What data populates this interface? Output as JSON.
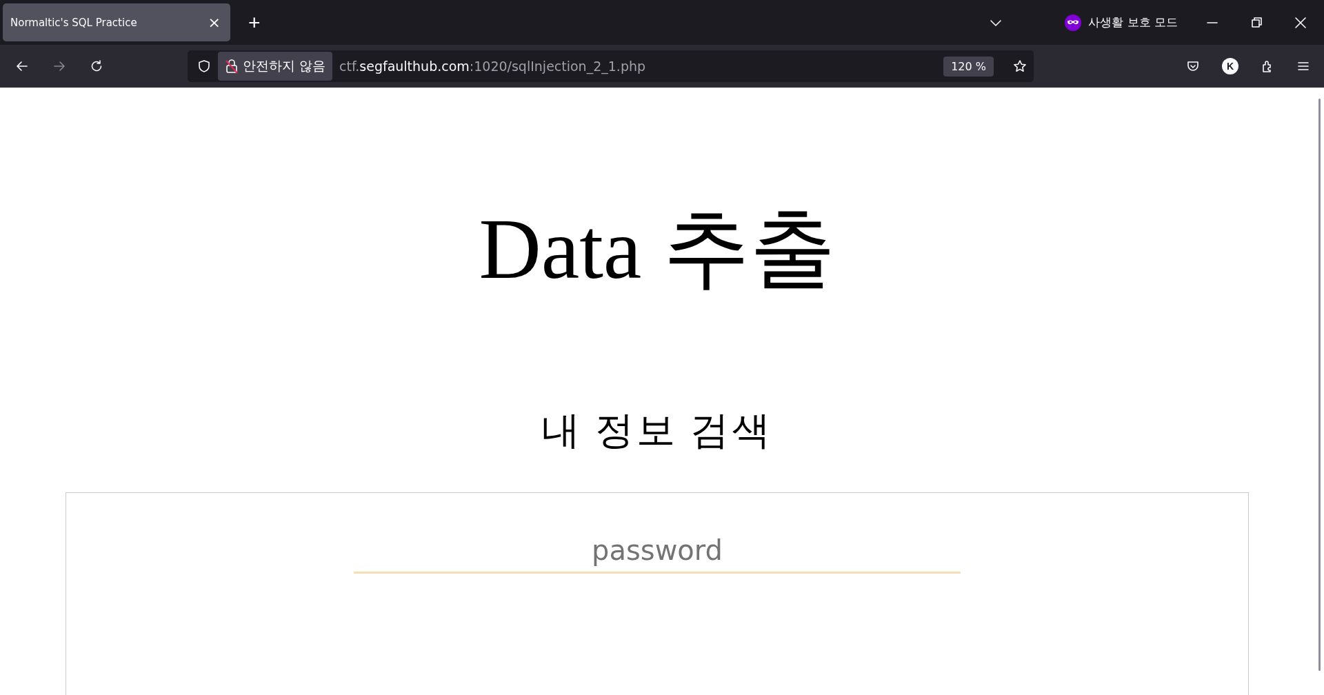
{
  "tabs": [
    {
      "title": "Normaltic's SQL Practice",
      "close": "×",
      "selected": true
    }
  ],
  "new_tab": "+",
  "private_mode": {
    "label": "사생활 보호 모드"
  },
  "toolbar": {
    "security_label": "안전하지 않음",
    "url": [
      {
        "text": "ctf.",
        "emphasis": false
      },
      {
        "text": "segfaulthub.com",
        "emphasis": true
      },
      {
        "text": ":1020/sqlInjection_2_1.php",
        "emphasis": false
      }
    ],
    "zoom": "120 %",
    "account_initial": "K"
  },
  "page": {
    "title": "Data 추출",
    "subtitle": "내 정보 검색",
    "form": {
      "password": {
        "placeholder": "password"
      }
    }
  }
}
